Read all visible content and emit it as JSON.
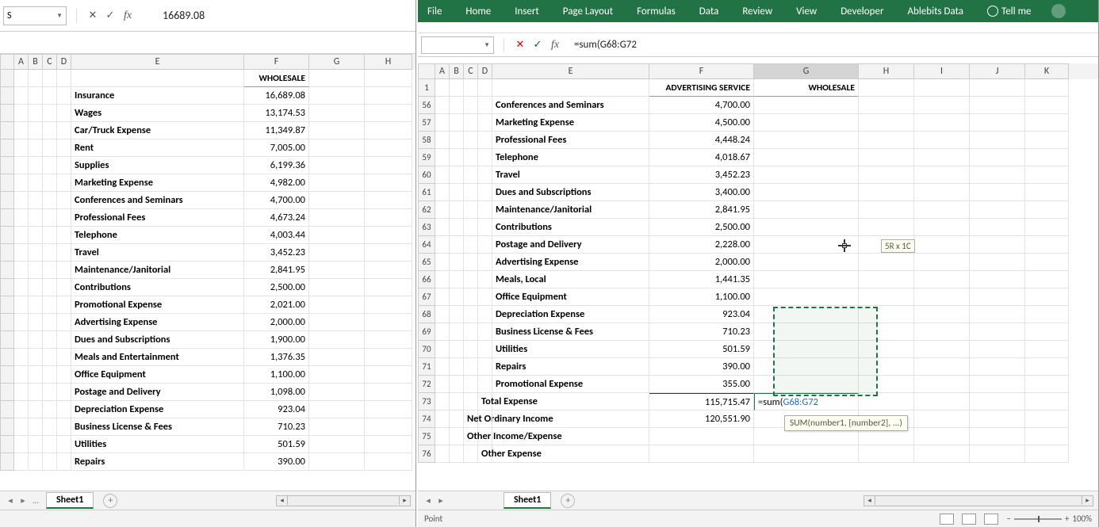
{
  "left": {
    "namebox": "S",
    "formula": "16689.08",
    "columns": [
      "A",
      "B",
      "C",
      "D",
      "E",
      "F",
      "G",
      "H"
    ],
    "header_F": "WHOLESALE",
    "rows": [
      {
        "label": "Insurance",
        "val": "16,689.08"
      },
      {
        "label": "Wages",
        "val": "13,174.53"
      },
      {
        "label": "Car/Truck Expense",
        "val": "11,349.87"
      },
      {
        "label": "Rent",
        "val": "7,005.00"
      },
      {
        "label": "Supplies",
        "val": "6,199.36"
      },
      {
        "label": "Marketing Expense",
        "val": "4,982.00"
      },
      {
        "label": "Conferences and Seminars",
        "val": "4,700.00"
      },
      {
        "label": "Professional Fees",
        "val": "4,673.24"
      },
      {
        "label": "Telephone",
        "val": "4,003.44"
      },
      {
        "label": "Travel",
        "val": "3,452.23"
      },
      {
        "label": "Maintenance/Janitorial",
        "val": "2,841.95"
      },
      {
        "label": "Contributions",
        "val": "2,500.00"
      },
      {
        "label": "Promotional Expense",
        "val": "2,021.00"
      },
      {
        "label": "Advertising Expense",
        "val": "2,000.00"
      },
      {
        "label": "Dues and Subscriptions",
        "val": "1,900.00"
      },
      {
        "label": "Meals and Entertainment",
        "val": "1,376.35"
      },
      {
        "label": "Office Equipment",
        "val": "1,100.00"
      },
      {
        "label": "Postage and Delivery",
        "val": "1,098.00"
      },
      {
        "label": "Depreciation Expense",
        "val": "923.04"
      },
      {
        "label": "Business License & Fees",
        "val": "710.23"
      },
      {
        "label": "Utilities",
        "val": "501.59"
      },
      {
        "label": "Repairs",
        "val": "390.00"
      }
    ],
    "sheet_tab": "Sheet1"
  },
  "right": {
    "ribbon": [
      "File",
      "Home",
      "Insert",
      "Page Layout",
      "Formulas",
      "Data",
      "Review",
      "View",
      "Developer",
      "Ablebits Data"
    ],
    "tellme": "Tell me",
    "namebox": "",
    "formula": "=sum(G68:G72",
    "columns": [
      "A",
      "B",
      "C",
      "D",
      "E",
      "F",
      "G",
      "H",
      "I",
      "J",
      "K"
    ],
    "header_F": "ADVERTISING SERVICE",
    "header_G": "WHOLESALE",
    "row1": "1",
    "rows": [
      {
        "n": "56",
        "label": "Conferences and Seminars",
        "val": "4,700.00"
      },
      {
        "n": "57",
        "label": "Marketing Expense",
        "val": "4,500.00"
      },
      {
        "n": "58",
        "label": "Professional Fees",
        "val": "4,448.24"
      },
      {
        "n": "59",
        "label": "Telephone",
        "val": "4,018.67"
      },
      {
        "n": "60",
        "label": "Travel",
        "val": "3,452.23"
      },
      {
        "n": "61",
        "label": "Dues and Subscriptions",
        "val": "3,400.00"
      },
      {
        "n": "62",
        "label": "Maintenance/Janitorial",
        "val": "2,841.95"
      },
      {
        "n": "63",
        "label": "Contributions",
        "val": "2,500.00"
      },
      {
        "n": "64",
        "label": "Postage and Delivery",
        "val": "2,228.00"
      },
      {
        "n": "65",
        "label": "Advertising Expense",
        "val": "2,000.00"
      },
      {
        "n": "66",
        "label": "Meals, Local",
        "val": "1,441.35"
      },
      {
        "n": "67",
        "label": "Office Equipment",
        "val": "1,100.00"
      },
      {
        "n": "68",
        "label": "Depreciation Expense",
        "val": "923.04"
      },
      {
        "n": "69",
        "label": "Business License & Fees",
        "val": "710.23"
      },
      {
        "n": "70",
        "label": "Utilities",
        "val": "501.59"
      },
      {
        "n": "71",
        "label": "Repairs",
        "val": "390.00"
      },
      {
        "n": "72",
        "label": "Promotional Expense",
        "val": "355.00"
      }
    ],
    "total_row": {
      "n": "73",
      "label": "Total Expense",
      "val": "115,715.47",
      "formula_prefix": "=sum(",
      "formula_ref": "G68:G72"
    },
    "net_row": {
      "n": "74",
      "label": "Net Ordinary Income",
      "val": "120,551.90"
    },
    "other_row": {
      "n": "75",
      "label": "Other Income/Expense"
    },
    "other_exp_row": {
      "n": "76",
      "label": "Other Expense"
    },
    "func_tip": "SUM(number1, [number2], ...)",
    "size_tip": "5R x 1C",
    "sheet_tab": "Sheet1",
    "status": "Point",
    "zoom": "100%"
  }
}
